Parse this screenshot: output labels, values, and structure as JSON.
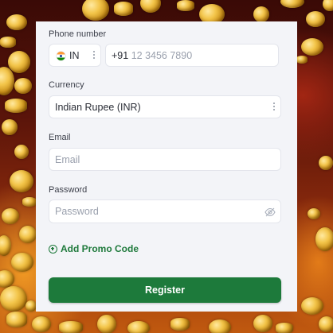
{
  "form": {
    "phone": {
      "label": "Phone number",
      "country_code": "IN",
      "dial_code": "+91",
      "placeholder": "12 3456 7890",
      "flag_icon": "india-flag-icon"
    },
    "currency": {
      "label": "Currency",
      "value": "Indian Rupee (INR)"
    },
    "email": {
      "label": "Email",
      "placeholder": "Email"
    },
    "password": {
      "label": "Password",
      "placeholder": "Password",
      "toggle_icon": "eye-off-icon"
    },
    "promo_label": "Add Promo Code",
    "register_label": "Register"
  },
  "colors": {
    "accent": "#1d7a3b",
    "card": "#f3f4f8",
    "field": "#ffffff"
  }
}
